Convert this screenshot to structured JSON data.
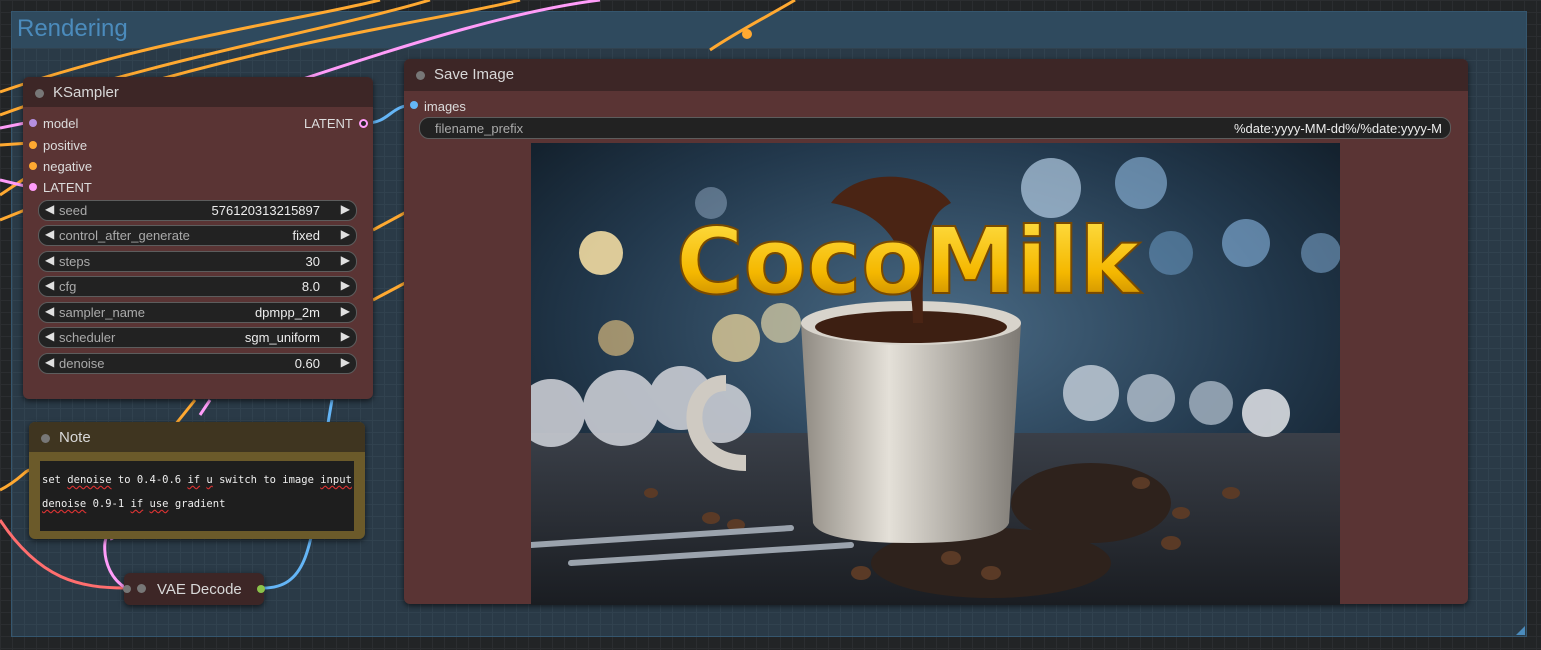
{
  "group": {
    "title": "Rendering"
  },
  "ksampler": {
    "title": "KSampler",
    "inputs": [
      "model",
      "positive",
      "negative",
      "LATENT"
    ],
    "output": "LATENT",
    "widgets": [
      {
        "label": "seed",
        "value": "576120313215897"
      },
      {
        "label": "control_after_generate",
        "value": "fixed"
      },
      {
        "label": "steps",
        "value": "30"
      },
      {
        "label": "cfg",
        "value": "8.0"
      },
      {
        "label": "sampler_name",
        "value": "dpmpp_2m"
      },
      {
        "label": "scheduler",
        "value": "sgm_uniform"
      },
      {
        "label": "denoise",
        "value": "0.60"
      }
    ]
  },
  "note": {
    "title": "Note",
    "line1": [
      "set",
      "denoise",
      "to 0.4-0.6",
      "if",
      "u",
      "switch to image",
      "input"
    ],
    "line2": [
      "denoise",
      "0.9-1",
      "if",
      "use",
      "gradient"
    ]
  },
  "vae_decode": {
    "title": "VAE Decode"
  },
  "save_image": {
    "title": "Save Image",
    "input": "images",
    "filename_label": "filename_prefix",
    "filename_value": "%date:yyyy-MM-dd%/%date:yyyy-M",
    "image_text": "CocoMilk"
  },
  "colors": {
    "model_slot": "#b48fe0",
    "conditioning_slot": "#ffa931",
    "latent_slot": "#ff9cf9",
    "image_slot": "#64b5f6",
    "vae_slot": "#ff6e6e",
    "node_body": "#5a3434",
    "node_title": "#3d2626",
    "note_body": "#6b5a2a",
    "group_title": "#4b8bbc"
  },
  "icons": {
    "left_arrow": "◀",
    "right_arrow": "▶"
  }
}
